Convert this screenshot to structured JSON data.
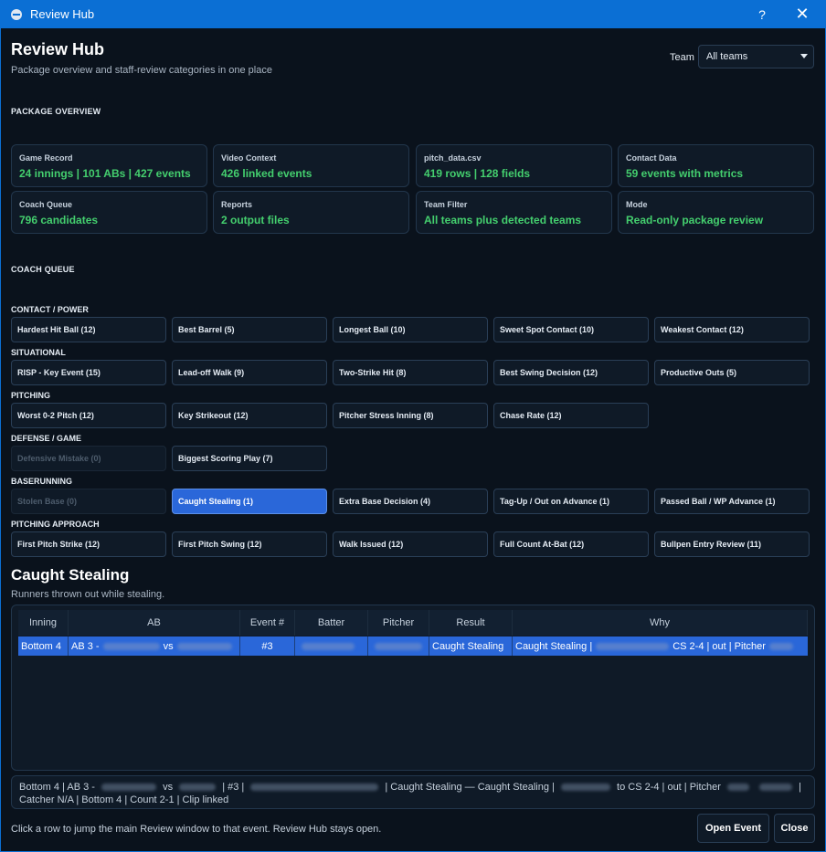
{
  "window": {
    "title": "Review Hub",
    "help_glyph": "?",
    "close_glyph": "✕"
  },
  "header": {
    "title": "Review Hub",
    "subtitle": "Package overview and staff-review categories in one place"
  },
  "team_filter": {
    "label": "Team",
    "selected": "All teams"
  },
  "overview": {
    "heading": "PACKAGE OVERVIEW",
    "cards": [
      {
        "label": "Game Record",
        "value": "24 innings | 101 ABs | 427 events"
      },
      {
        "label": "Video Context",
        "value": "426 linked events"
      },
      {
        "label": "pitch_data.csv",
        "value": "419 rows | 128 fields"
      },
      {
        "label": "Contact Data",
        "value": "59 events with metrics"
      },
      {
        "label": "Coach Queue",
        "value": "796 candidates"
      },
      {
        "label": "Reports",
        "value": "2 output files"
      },
      {
        "label": "Team Filter",
        "value": "All teams plus detected teams"
      },
      {
        "label": "Mode",
        "value": "Read-only package review"
      }
    ],
    "value_color": "#44cf6e"
  },
  "queue": {
    "heading": "COACH QUEUE",
    "categories": [
      {
        "name": "CONTACT / POWER",
        "buttons": [
          "Hardest Hit Ball (12)",
          "Best Barrel (5)",
          "Longest Ball (10)",
          "Sweet Spot Contact (10)",
          "Weakest Contact (12)"
        ]
      },
      {
        "name": "SITUATIONAL",
        "buttons": [
          "RISP - Key Event (15)",
          "Lead-off Walk (9)",
          "Two-Strike Hit (8)",
          "Best Swing Decision (12)",
          "Productive Outs (5)"
        ]
      },
      {
        "name": "PITCHING",
        "buttons": [
          "Worst 0-2 Pitch (12)",
          "Key Strikeout (12)",
          "Pitcher Stress Inning (8)",
          "Chase Rate (12)"
        ]
      },
      {
        "name": "DEFENSE / GAME",
        "buttons": [
          "Defensive Mistake (0)",
          "Biggest Scoring Play (7)"
        ]
      },
      {
        "name": "BASERUNNING",
        "buttons": [
          "Stolen Base (0)",
          "Caught Stealing (1)",
          "Extra Base Decision (4)",
          "Tag-Up / Out on Advance (1)",
          "Passed Ball / WP Advance (1)"
        ]
      },
      {
        "name": "PITCHING APPROACH",
        "buttons": [
          "First Pitch Strike (12)",
          "First Pitch Swing (12)",
          "Walk Issued (12)",
          "Full Count At-Bat (12)",
          "Bullpen Entry Review (11)"
        ]
      }
    ],
    "active": "Caught Stealing (1)",
    "accent_color": "#2a67d9"
  },
  "detail": {
    "title": "Caught Stealing",
    "subtitle": "Runners thrown out while stealing.",
    "columns": [
      "Inning",
      "AB",
      "Event #",
      "Batter",
      "Pitcher",
      "Result",
      "Why"
    ],
    "row": {
      "inning": "Bottom 4",
      "ab_prefix": "AB 3 -",
      "ab_vs": "vs",
      "event": "#3",
      "result": "Caught Stealing",
      "why_prefix": "Caught Stealing |",
      "why_mid": "CS 2-4 | out | Pitcher"
    }
  },
  "summary": {
    "p1": "Bottom 4 | AB 3 -",
    "p2": "vs",
    "p3": "| #3 |",
    "p4": "| Caught Stealing — Caught Stealing |",
    "p5": "to CS 2-4 | out | Pitcher",
    "p6": "| Catcher N/A | Bottom 4 | Count 2-1 | Clip linked"
  },
  "footer": {
    "note": "Click a row to jump the main Review window to that event. Review Hub stays open.",
    "open_label": "Open Event",
    "close_label": "Close"
  }
}
